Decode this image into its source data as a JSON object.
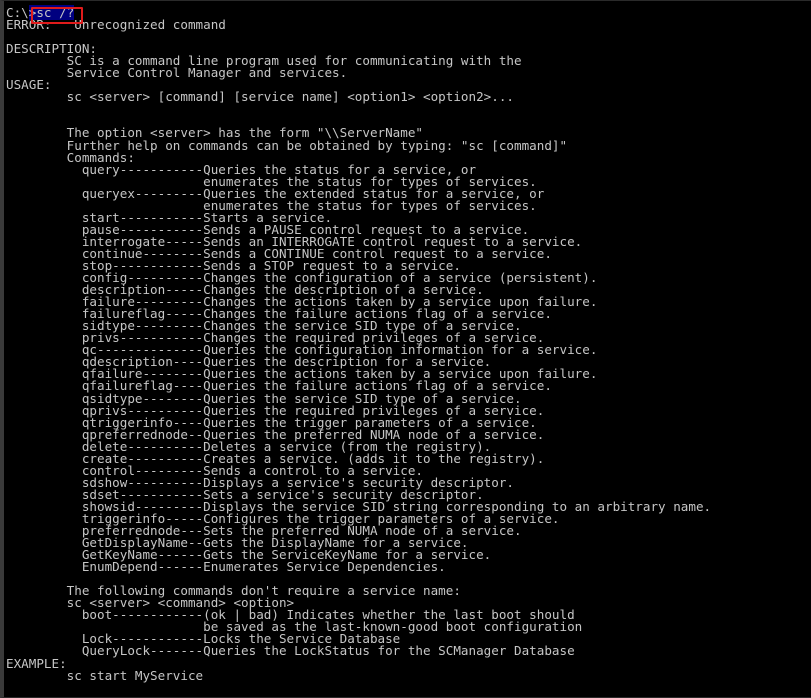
{
  "window": {
    "title": "Command Prompt",
    "background_color": "#000000",
    "text_color": "#c6c6c6",
    "selection_color": "#000080",
    "annotation_color": "#e01b1b"
  },
  "prompt": {
    "path": "C:\\",
    "symbol": ">",
    "command": "sc /?",
    "selected_text": ">sc /?"
  },
  "annotation": {
    "shape": "rectangle",
    "color": "#e01b1b",
    "targets": "prompt-command"
  },
  "output": {
    "error_label": "ERROR:",
    "error_message": "Unrecognized command",
    "description_label": "DESCRIPTION:",
    "description_lines": [
      "SC is a command line program used for communicating with the",
      "Service Control Manager and services."
    ],
    "usage_label": "USAGE:",
    "usage_syntax": "sc <server> [command] [service name] <option1> <option2>...",
    "server_form_note": "The option <server> has the form \"\\\\ServerName\"",
    "further_help_note": "Further help on commands can be obtained by typing: \"sc [command]\"",
    "commands_label": "Commands:",
    "commands": [
      {
        "name": "query",
        "description": "Queries the status for a service, or",
        "continuation": "enumerates the status for types of services."
      },
      {
        "name": "queryex",
        "description": "Queries the extended status for a service, or",
        "continuation": "enumerates the status for types of services."
      },
      {
        "name": "start",
        "description": "Starts a service.",
        "continuation": ""
      },
      {
        "name": "pause",
        "description": "Sends a PAUSE control request to a service.",
        "continuation": ""
      },
      {
        "name": "interrogate",
        "description": "Sends an INTERROGATE control request to a service.",
        "continuation": ""
      },
      {
        "name": "continue",
        "description": "Sends a CONTINUE control request to a service.",
        "continuation": ""
      },
      {
        "name": "stop",
        "description": "Sends a STOP request to a service.",
        "continuation": ""
      },
      {
        "name": "config",
        "description": "Changes the configuration of a service (persistent).",
        "continuation": ""
      },
      {
        "name": "description",
        "description": "Changes the description of a service.",
        "continuation": ""
      },
      {
        "name": "failure",
        "description": "Changes the actions taken by a service upon failure.",
        "continuation": ""
      },
      {
        "name": "failureflag",
        "description": "Changes the failure actions flag of a service.",
        "continuation": ""
      },
      {
        "name": "sidtype",
        "description": "Changes the service SID type of a service.",
        "continuation": ""
      },
      {
        "name": "privs",
        "description": "Changes the required privileges of a service.",
        "continuation": ""
      },
      {
        "name": "qc",
        "description": "Queries the configuration information for a service.",
        "continuation": ""
      },
      {
        "name": "qdescription",
        "description": "Queries the description for a service.",
        "continuation": ""
      },
      {
        "name": "qfailure",
        "description": "Queries the actions taken by a service upon failure.",
        "continuation": ""
      },
      {
        "name": "qfailureflag",
        "description": "Queries the failure actions flag of a service.",
        "continuation": ""
      },
      {
        "name": "qsidtype",
        "description": "Queries the service SID type of a service.",
        "continuation": ""
      },
      {
        "name": "qprivs",
        "description": "Queries the required privileges of a service.",
        "continuation": ""
      },
      {
        "name": "qtriggerinfo",
        "description": "Queries the trigger parameters of a service.",
        "continuation": ""
      },
      {
        "name": "qpreferrednode",
        "description": "Queries the preferred NUMA node of a service.",
        "continuation": ""
      },
      {
        "name": "delete",
        "description": "Deletes a service (from the registry).",
        "continuation": ""
      },
      {
        "name": "create",
        "description": "Creates a service. (adds it to the registry).",
        "continuation": ""
      },
      {
        "name": "control",
        "description": "Sends a control to a service.",
        "continuation": ""
      },
      {
        "name": "sdshow",
        "description": "Displays a service's security descriptor.",
        "continuation": ""
      },
      {
        "name": "sdset",
        "description": "Sets a service's security descriptor.",
        "continuation": ""
      },
      {
        "name": "showsid",
        "description": "Displays the service SID string corresponding to an arbitrary name.",
        "continuation": ""
      },
      {
        "name": "triggerinfo",
        "description": "Configures the trigger parameters of a service.",
        "continuation": ""
      },
      {
        "name": "preferrednode",
        "description": "Sets the preferred NUMA node of a service.",
        "continuation": ""
      },
      {
        "name": "GetDisplayName",
        "description": "Gets the DisplayName for a service.",
        "continuation": ""
      },
      {
        "name": "GetKeyName",
        "description": "Gets the ServiceKeyName for a service.",
        "continuation": ""
      },
      {
        "name": "EnumDepend",
        "description": "Enumerates Service Dependencies.",
        "continuation": ""
      }
    ],
    "no_service_name_note": "The following commands don't require a service name:",
    "no_service_name_syntax": "sc <server> <command> <option>",
    "no_service_commands": [
      {
        "name": "boot",
        "description": "(ok | bad) Indicates whether the last boot should",
        "continuation": "be saved as the last-known-good boot configuration"
      },
      {
        "name": "Lock",
        "description": "Locks the Service Database",
        "continuation": ""
      },
      {
        "name": "QueryLock",
        "description": "Queries the LockStatus for the SCManager Database",
        "continuation": ""
      }
    ],
    "example_label": "EXAMPLE:",
    "example_command": "sc start MyService"
  }
}
